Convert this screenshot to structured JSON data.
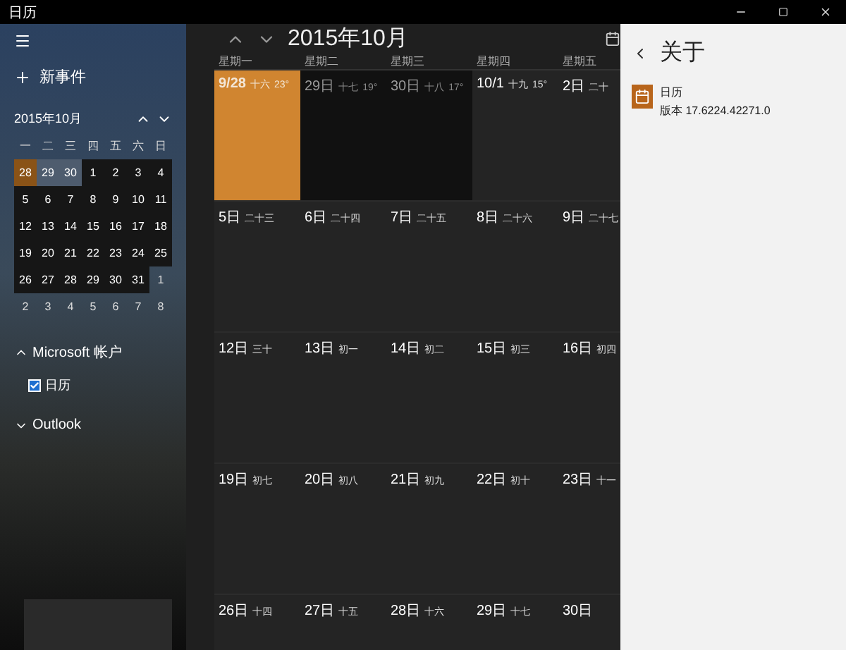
{
  "window": {
    "title": "日历",
    "controls": [
      {
        "kind": "minimize"
      },
      {
        "kind": "maximize"
      },
      {
        "kind": "close"
      }
    ]
  },
  "sidebar": {
    "new_event": "新事件",
    "mini_calendar": {
      "title": "2015年10月",
      "weekdays": [
        "一",
        "二",
        "三",
        "四",
        "五",
        "六",
        "日"
      ],
      "days": [
        {
          "label": "28",
          "kind": "today"
        },
        {
          "label": "29",
          "kind": "week"
        },
        {
          "label": "30",
          "kind": "week"
        },
        {
          "label": "1",
          "kind": "month"
        },
        {
          "label": "2",
          "kind": "month"
        },
        {
          "label": "3",
          "kind": "month"
        },
        {
          "label": "4",
          "kind": "month"
        },
        {
          "label": "5",
          "kind": "month"
        },
        {
          "label": "6",
          "kind": "month"
        },
        {
          "label": "7",
          "kind": "month"
        },
        {
          "label": "8",
          "kind": "month"
        },
        {
          "label": "9",
          "kind": "month"
        },
        {
          "label": "10",
          "kind": "month"
        },
        {
          "label": "11",
          "kind": "month"
        },
        {
          "label": "12",
          "kind": "month"
        },
        {
          "label": "13",
          "kind": "month"
        },
        {
          "label": "14",
          "kind": "month"
        },
        {
          "label": "15",
          "kind": "month"
        },
        {
          "label": "16",
          "kind": "month"
        },
        {
          "label": "17",
          "kind": "month"
        },
        {
          "label": "18",
          "kind": "month"
        },
        {
          "label": "19",
          "kind": "month"
        },
        {
          "label": "20",
          "kind": "month"
        },
        {
          "label": "21",
          "kind": "month"
        },
        {
          "label": "22",
          "kind": "month"
        },
        {
          "label": "23",
          "kind": "month"
        },
        {
          "label": "24",
          "kind": "month"
        },
        {
          "label": "25",
          "kind": "month"
        },
        {
          "label": "26",
          "kind": "month"
        },
        {
          "label": "27",
          "kind": "month"
        },
        {
          "label": "28",
          "kind": "month"
        },
        {
          "label": "29",
          "kind": "month"
        },
        {
          "label": "30",
          "kind": "month"
        },
        {
          "label": "31",
          "kind": "month"
        },
        {
          "label": "1",
          "kind": "outside"
        },
        {
          "label": "2",
          "kind": "outside"
        },
        {
          "label": "3",
          "kind": "outside"
        },
        {
          "label": "4",
          "kind": "outside"
        },
        {
          "label": "5",
          "kind": "outside"
        },
        {
          "label": "6",
          "kind": "outside"
        },
        {
          "label": "7",
          "kind": "outside"
        },
        {
          "label": "8",
          "kind": "outside"
        }
      ]
    },
    "accounts": [
      {
        "name": "Microsoft 帐户",
        "expanded": true,
        "calendars": [
          {
            "name": "日历",
            "checked": true
          }
        ]
      },
      {
        "name": "Outlook",
        "expanded": false
      }
    ]
  },
  "main": {
    "title": "2015年10月",
    "weekdays": [
      "星期一",
      "星期二",
      "星期三",
      "星期四",
      "星期五"
    ],
    "weeks": [
      [
        {
          "date": "9/28",
          "lunar": "十六",
          "temp": "23°",
          "today": true,
          "other_month": true
        },
        {
          "date": "29日",
          "lunar": "十七",
          "temp": "19°",
          "today": false,
          "other_month": true
        },
        {
          "date": "30日",
          "lunar": "十八",
          "temp": "17°",
          "today": false,
          "other_month": true
        },
        {
          "date": "10/1",
          "lunar": "十九",
          "temp": "15°",
          "today": false,
          "other_month": false
        },
        {
          "date": "2日",
          "lunar": "二十",
          "today": false,
          "other_month": false
        }
      ],
      [
        {
          "date": "5日",
          "lunar": "二十三",
          "today": false,
          "other_month": false
        },
        {
          "date": "6日",
          "lunar": "二十四",
          "today": false,
          "other_month": false
        },
        {
          "date": "7日",
          "lunar": "二十五",
          "today": false,
          "other_month": false
        },
        {
          "date": "8日",
          "lunar": "二十六",
          "today": false,
          "other_month": false
        },
        {
          "date": "9日",
          "lunar": "二十七",
          "today": false,
          "other_month": false
        }
      ],
      [
        {
          "date": "12日",
          "lunar": "三十",
          "today": false,
          "other_month": false
        },
        {
          "date": "13日",
          "lunar": "初一",
          "today": false,
          "other_month": false
        },
        {
          "date": "14日",
          "lunar": "初二",
          "today": false,
          "other_month": false
        },
        {
          "date": "15日",
          "lunar": "初三",
          "today": false,
          "other_month": false
        },
        {
          "date": "16日",
          "lunar": "初四",
          "today": false,
          "other_month": false
        }
      ],
      [
        {
          "date": "19日",
          "lunar": "初七",
          "today": false,
          "other_month": false
        },
        {
          "date": "20日",
          "lunar": "初八",
          "today": false,
          "other_month": false
        },
        {
          "date": "21日",
          "lunar": "初九",
          "today": false,
          "other_month": false
        },
        {
          "date": "22日",
          "lunar": "初十",
          "today": false,
          "other_month": false
        },
        {
          "date": "23日",
          "lunar": "十一",
          "today": false,
          "other_month": false
        }
      ],
      [
        {
          "date": "26日",
          "lunar": "十四",
          "today": false,
          "other_month": false
        },
        {
          "date": "27日",
          "lunar": "十五",
          "today": false,
          "other_month": false
        },
        {
          "date": "28日",
          "lunar": "十六",
          "today": false,
          "other_month": false
        },
        {
          "date": "29日",
          "lunar": "十七",
          "today": false,
          "other_month": false
        },
        {
          "date": "30日",
          "today": false,
          "other_month": false
        }
      ]
    ]
  },
  "about": {
    "title": "关于",
    "app_name": "日历",
    "version": "版本 17.6224.42271.0"
  }
}
